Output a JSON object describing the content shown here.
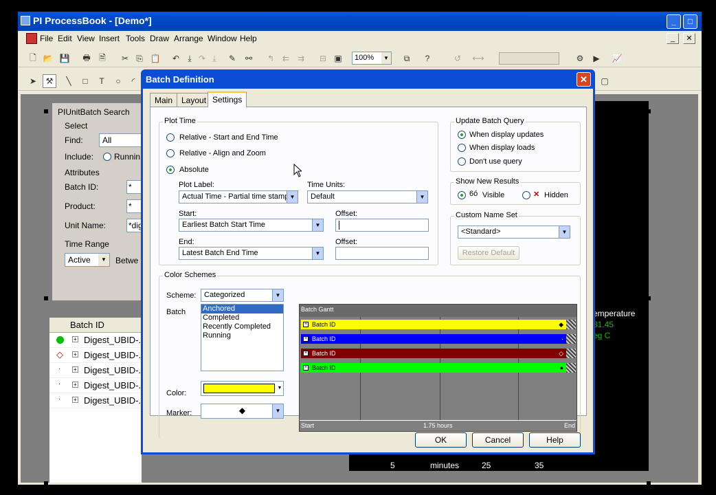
{
  "window": {
    "title": "PI ProcessBook - [Demo*]"
  },
  "menu": [
    "File",
    "Edit",
    "View",
    "Insert",
    "Tools",
    "Draw",
    "Arrange",
    "Window",
    "Help"
  ],
  "toolbar": {
    "zoom": "100%"
  },
  "search_panel": {
    "title": "PIUnitBatch Search",
    "select": "Select",
    "find_label": "Find:",
    "find_value": "All",
    "include_label": "Include:",
    "include_option": "Runnin",
    "attributes": "Attributes",
    "batch_id_label": "Batch ID:",
    "batch_id_value": "*",
    "product_label": "Product:",
    "product_value": "*",
    "unit_name_label": "Unit Name:",
    "unit_name_value": "*dig",
    "time_range": "Time Range",
    "time_range_value": "Active",
    "between": "Betwe"
  },
  "batch_list": {
    "header": "Batch ID",
    "rows": [
      "Digest_UBID-.",
      "Digest_UBID-.",
      "Digest_UBID-.",
      "Digest_UBID-.",
      "Digest_UBID-."
    ]
  },
  "trend": {
    "label": "emperature",
    "value": "81.45",
    "unit": "eg C",
    "axis": [
      "5",
      "minutes",
      "25",
      "35"
    ]
  },
  "dialog": {
    "title": "Batch Definition",
    "tabs": [
      "Main",
      "Layout",
      "Settings"
    ],
    "plot_time": {
      "title": "Plot Time",
      "options": [
        "Relative - Start and End Time",
        "Relative - Align and Zoom",
        "Absolute"
      ],
      "selected": 2,
      "plot_label": "Plot Label:",
      "plot_label_value": "Actual Time - Partial time stamp",
      "time_units": "Time Units:",
      "time_units_value": "Default",
      "start": "Start:",
      "start_value": "Earliest Batch Start Time",
      "offset1": "Offset:",
      "end": "End:",
      "end_value": "Latest Batch End Time",
      "offset2": "Offset:"
    },
    "update_query": {
      "title": "Update Batch Query",
      "options": [
        "When display updates",
        "When display loads",
        "Don't use query"
      ],
      "selected": 0
    },
    "show_new": {
      "title": "Show New Results",
      "visible": "Visible",
      "hidden": "Hidden"
    },
    "custom_name": {
      "title": "Custom Name Set",
      "value": "<Standard>",
      "restore": "Restore Default"
    },
    "color_schemes": {
      "title": "Color Schemes",
      "scheme_label": "Scheme:",
      "scheme_value": "Categorized",
      "batch_label": "Batch",
      "batch_items": [
        "Anchored",
        "Completed",
        "Recently Completed",
        "Running"
      ],
      "color_label": "Color:",
      "color_value": "#ffff00",
      "marker_label": "Marker:",
      "marker_value": "◆"
    },
    "gantt": {
      "title": "Batch Gantt",
      "bars": [
        {
          "label": "Batch ID",
          "color": "#ffff00",
          "text": "#000000",
          "marker": "◆"
        },
        {
          "label": "Batch ID",
          "color": "#0000ff",
          "text": "#ffffff",
          "marker": "·"
        },
        {
          "label": "Batch ID",
          "color": "#800000",
          "text": "#ffffff",
          "marker": "◇"
        },
        {
          "label": "Batch ID",
          "color": "#00ff00",
          "text": "#000000",
          "marker": "●"
        }
      ],
      "start": "Start",
      "duration": "1.75 hours",
      "end": "End"
    },
    "buttons": {
      "ok": "OK",
      "cancel": "Cancel",
      "help": "Help"
    }
  }
}
